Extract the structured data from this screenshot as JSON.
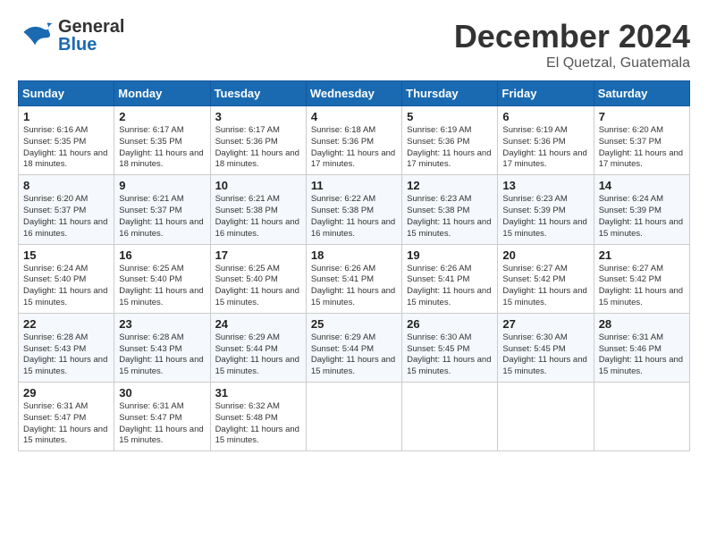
{
  "header": {
    "month_year": "December 2024",
    "location": "El Quetzal, Guatemala",
    "logo_general": "General",
    "logo_blue": "Blue"
  },
  "weekdays": [
    "Sunday",
    "Monday",
    "Tuesday",
    "Wednesday",
    "Thursday",
    "Friday",
    "Saturday"
  ],
  "weeks": [
    [
      {
        "day": "1",
        "sunrise": "Sunrise: 6:16 AM",
        "sunset": "Sunset: 5:35 PM",
        "daylight": "Daylight: 11 hours and 18 minutes."
      },
      {
        "day": "2",
        "sunrise": "Sunrise: 6:17 AM",
        "sunset": "Sunset: 5:35 PM",
        "daylight": "Daylight: 11 hours and 18 minutes."
      },
      {
        "day": "3",
        "sunrise": "Sunrise: 6:17 AM",
        "sunset": "Sunset: 5:36 PM",
        "daylight": "Daylight: 11 hours and 18 minutes."
      },
      {
        "day": "4",
        "sunrise": "Sunrise: 6:18 AM",
        "sunset": "Sunset: 5:36 PM",
        "daylight": "Daylight: 11 hours and 17 minutes."
      },
      {
        "day": "5",
        "sunrise": "Sunrise: 6:19 AM",
        "sunset": "Sunset: 5:36 PM",
        "daylight": "Daylight: 11 hours and 17 minutes."
      },
      {
        "day": "6",
        "sunrise": "Sunrise: 6:19 AM",
        "sunset": "Sunset: 5:36 PM",
        "daylight": "Daylight: 11 hours and 17 minutes."
      },
      {
        "day": "7",
        "sunrise": "Sunrise: 6:20 AM",
        "sunset": "Sunset: 5:37 PM",
        "daylight": "Daylight: 11 hours and 17 minutes."
      }
    ],
    [
      {
        "day": "8",
        "sunrise": "Sunrise: 6:20 AM",
        "sunset": "Sunset: 5:37 PM",
        "daylight": "Daylight: 11 hours and 16 minutes."
      },
      {
        "day": "9",
        "sunrise": "Sunrise: 6:21 AM",
        "sunset": "Sunset: 5:37 PM",
        "daylight": "Daylight: 11 hours and 16 minutes."
      },
      {
        "day": "10",
        "sunrise": "Sunrise: 6:21 AM",
        "sunset": "Sunset: 5:38 PM",
        "daylight": "Daylight: 11 hours and 16 minutes."
      },
      {
        "day": "11",
        "sunrise": "Sunrise: 6:22 AM",
        "sunset": "Sunset: 5:38 PM",
        "daylight": "Daylight: 11 hours and 16 minutes."
      },
      {
        "day": "12",
        "sunrise": "Sunrise: 6:23 AM",
        "sunset": "Sunset: 5:38 PM",
        "daylight": "Daylight: 11 hours and 15 minutes."
      },
      {
        "day": "13",
        "sunrise": "Sunrise: 6:23 AM",
        "sunset": "Sunset: 5:39 PM",
        "daylight": "Daylight: 11 hours and 15 minutes."
      },
      {
        "day": "14",
        "sunrise": "Sunrise: 6:24 AM",
        "sunset": "Sunset: 5:39 PM",
        "daylight": "Daylight: 11 hours and 15 minutes."
      }
    ],
    [
      {
        "day": "15",
        "sunrise": "Sunrise: 6:24 AM",
        "sunset": "Sunset: 5:40 PM",
        "daylight": "Daylight: 11 hours and 15 minutes."
      },
      {
        "day": "16",
        "sunrise": "Sunrise: 6:25 AM",
        "sunset": "Sunset: 5:40 PM",
        "daylight": "Daylight: 11 hours and 15 minutes."
      },
      {
        "day": "17",
        "sunrise": "Sunrise: 6:25 AM",
        "sunset": "Sunset: 5:40 PM",
        "daylight": "Daylight: 11 hours and 15 minutes."
      },
      {
        "day": "18",
        "sunrise": "Sunrise: 6:26 AM",
        "sunset": "Sunset: 5:41 PM",
        "daylight": "Daylight: 11 hours and 15 minutes."
      },
      {
        "day": "19",
        "sunrise": "Sunrise: 6:26 AM",
        "sunset": "Sunset: 5:41 PM",
        "daylight": "Daylight: 11 hours and 15 minutes."
      },
      {
        "day": "20",
        "sunrise": "Sunrise: 6:27 AM",
        "sunset": "Sunset: 5:42 PM",
        "daylight": "Daylight: 11 hours and 15 minutes."
      },
      {
        "day": "21",
        "sunrise": "Sunrise: 6:27 AM",
        "sunset": "Sunset: 5:42 PM",
        "daylight": "Daylight: 11 hours and 15 minutes."
      }
    ],
    [
      {
        "day": "22",
        "sunrise": "Sunrise: 6:28 AM",
        "sunset": "Sunset: 5:43 PM",
        "daylight": "Daylight: 11 hours and 15 minutes."
      },
      {
        "day": "23",
        "sunrise": "Sunrise: 6:28 AM",
        "sunset": "Sunset: 5:43 PM",
        "daylight": "Daylight: 11 hours and 15 minutes."
      },
      {
        "day": "24",
        "sunrise": "Sunrise: 6:29 AM",
        "sunset": "Sunset: 5:44 PM",
        "daylight": "Daylight: 11 hours and 15 minutes."
      },
      {
        "day": "25",
        "sunrise": "Sunrise: 6:29 AM",
        "sunset": "Sunset: 5:44 PM",
        "daylight": "Daylight: 11 hours and 15 minutes."
      },
      {
        "day": "26",
        "sunrise": "Sunrise: 6:30 AM",
        "sunset": "Sunset: 5:45 PM",
        "daylight": "Daylight: 11 hours and 15 minutes."
      },
      {
        "day": "27",
        "sunrise": "Sunrise: 6:30 AM",
        "sunset": "Sunset: 5:45 PM",
        "daylight": "Daylight: 11 hours and 15 minutes."
      },
      {
        "day": "28",
        "sunrise": "Sunrise: 6:31 AM",
        "sunset": "Sunset: 5:46 PM",
        "daylight": "Daylight: 11 hours and 15 minutes."
      }
    ],
    [
      {
        "day": "29",
        "sunrise": "Sunrise: 6:31 AM",
        "sunset": "Sunset: 5:47 PM",
        "daylight": "Daylight: 11 hours and 15 minutes."
      },
      {
        "day": "30",
        "sunrise": "Sunrise: 6:31 AM",
        "sunset": "Sunset: 5:47 PM",
        "daylight": "Daylight: 11 hours and 15 minutes."
      },
      {
        "day": "31",
        "sunrise": "Sunrise: 6:32 AM",
        "sunset": "Sunset: 5:48 PM",
        "daylight": "Daylight: 11 hours and 15 minutes."
      },
      null,
      null,
      null,
      null
    ]
  ]
}
